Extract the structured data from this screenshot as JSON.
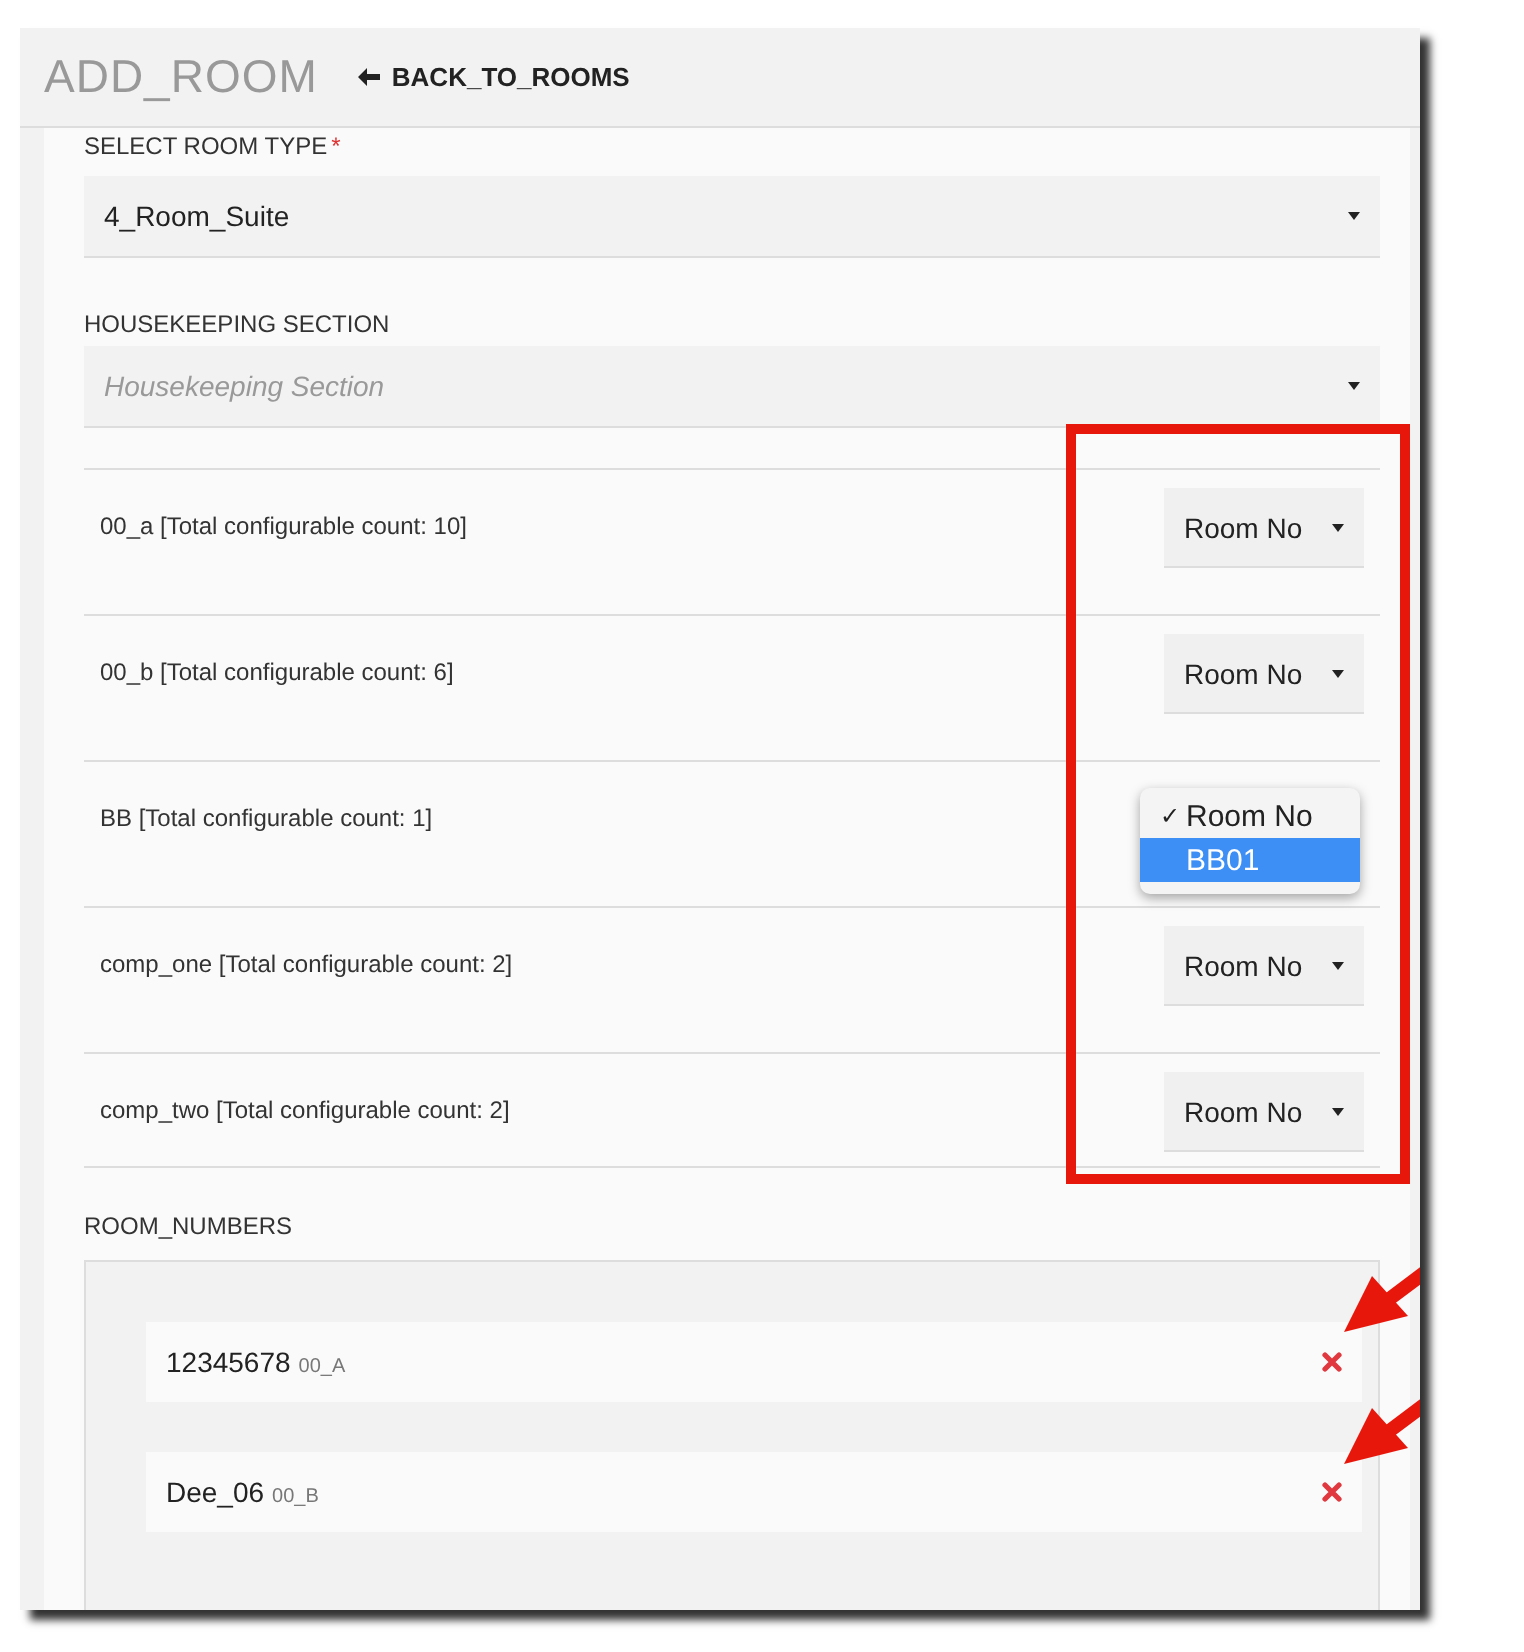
{
  "header": {
    "title": "ADD_ROOM",
    "back_link": "BACK_TO_ROOMS"
  },
  "room_type": {
    "label": "SELECT ROOM TYPE",
    "required_mark": "*",
    "value": "4_Room_Suite"
  },
  "housekeeping": {
    "label": "HOUSEKEEPING SECTION",
    "placeholder": "Housekeeping Section"
  },
  "components": [
    {
      "label": "00_a [Total configurable count: 10]",
      "select": "Room No",
      "open": false
    },
    {
      "label": "00_b [Total configurable count: 6]",
      "select": "Room No",
      "open": false
    },
    {
      "label": "BB [Total configurable count: 1]",
      "open": true,
      "check_mark": "✓",
      "options": [
        {
          "label": "Room No",
          "checked": true,
          "highlighted": false
        },
        {
          "label": "BB01",
          "checked": false,
          "highlighted": true
        }
      ]
    },
    {
      "label": "comp_one [Total configurable count: 2]",
      "select": "Room No",
      "open": false
    },
    {
      "label": "comp_two [Total configurable count: 2]",
      "select": "Room No",
      "open": false
    }
  ],
  "room_numbers": {
    "label": "ROOM_NUMBERS",
    "items": [
      {
        "number": "12345678",
        "component": "00_A"
      },
      {
        "number": "Dee_06",
        "component": "00_B"
      }
    ]
  }
}
